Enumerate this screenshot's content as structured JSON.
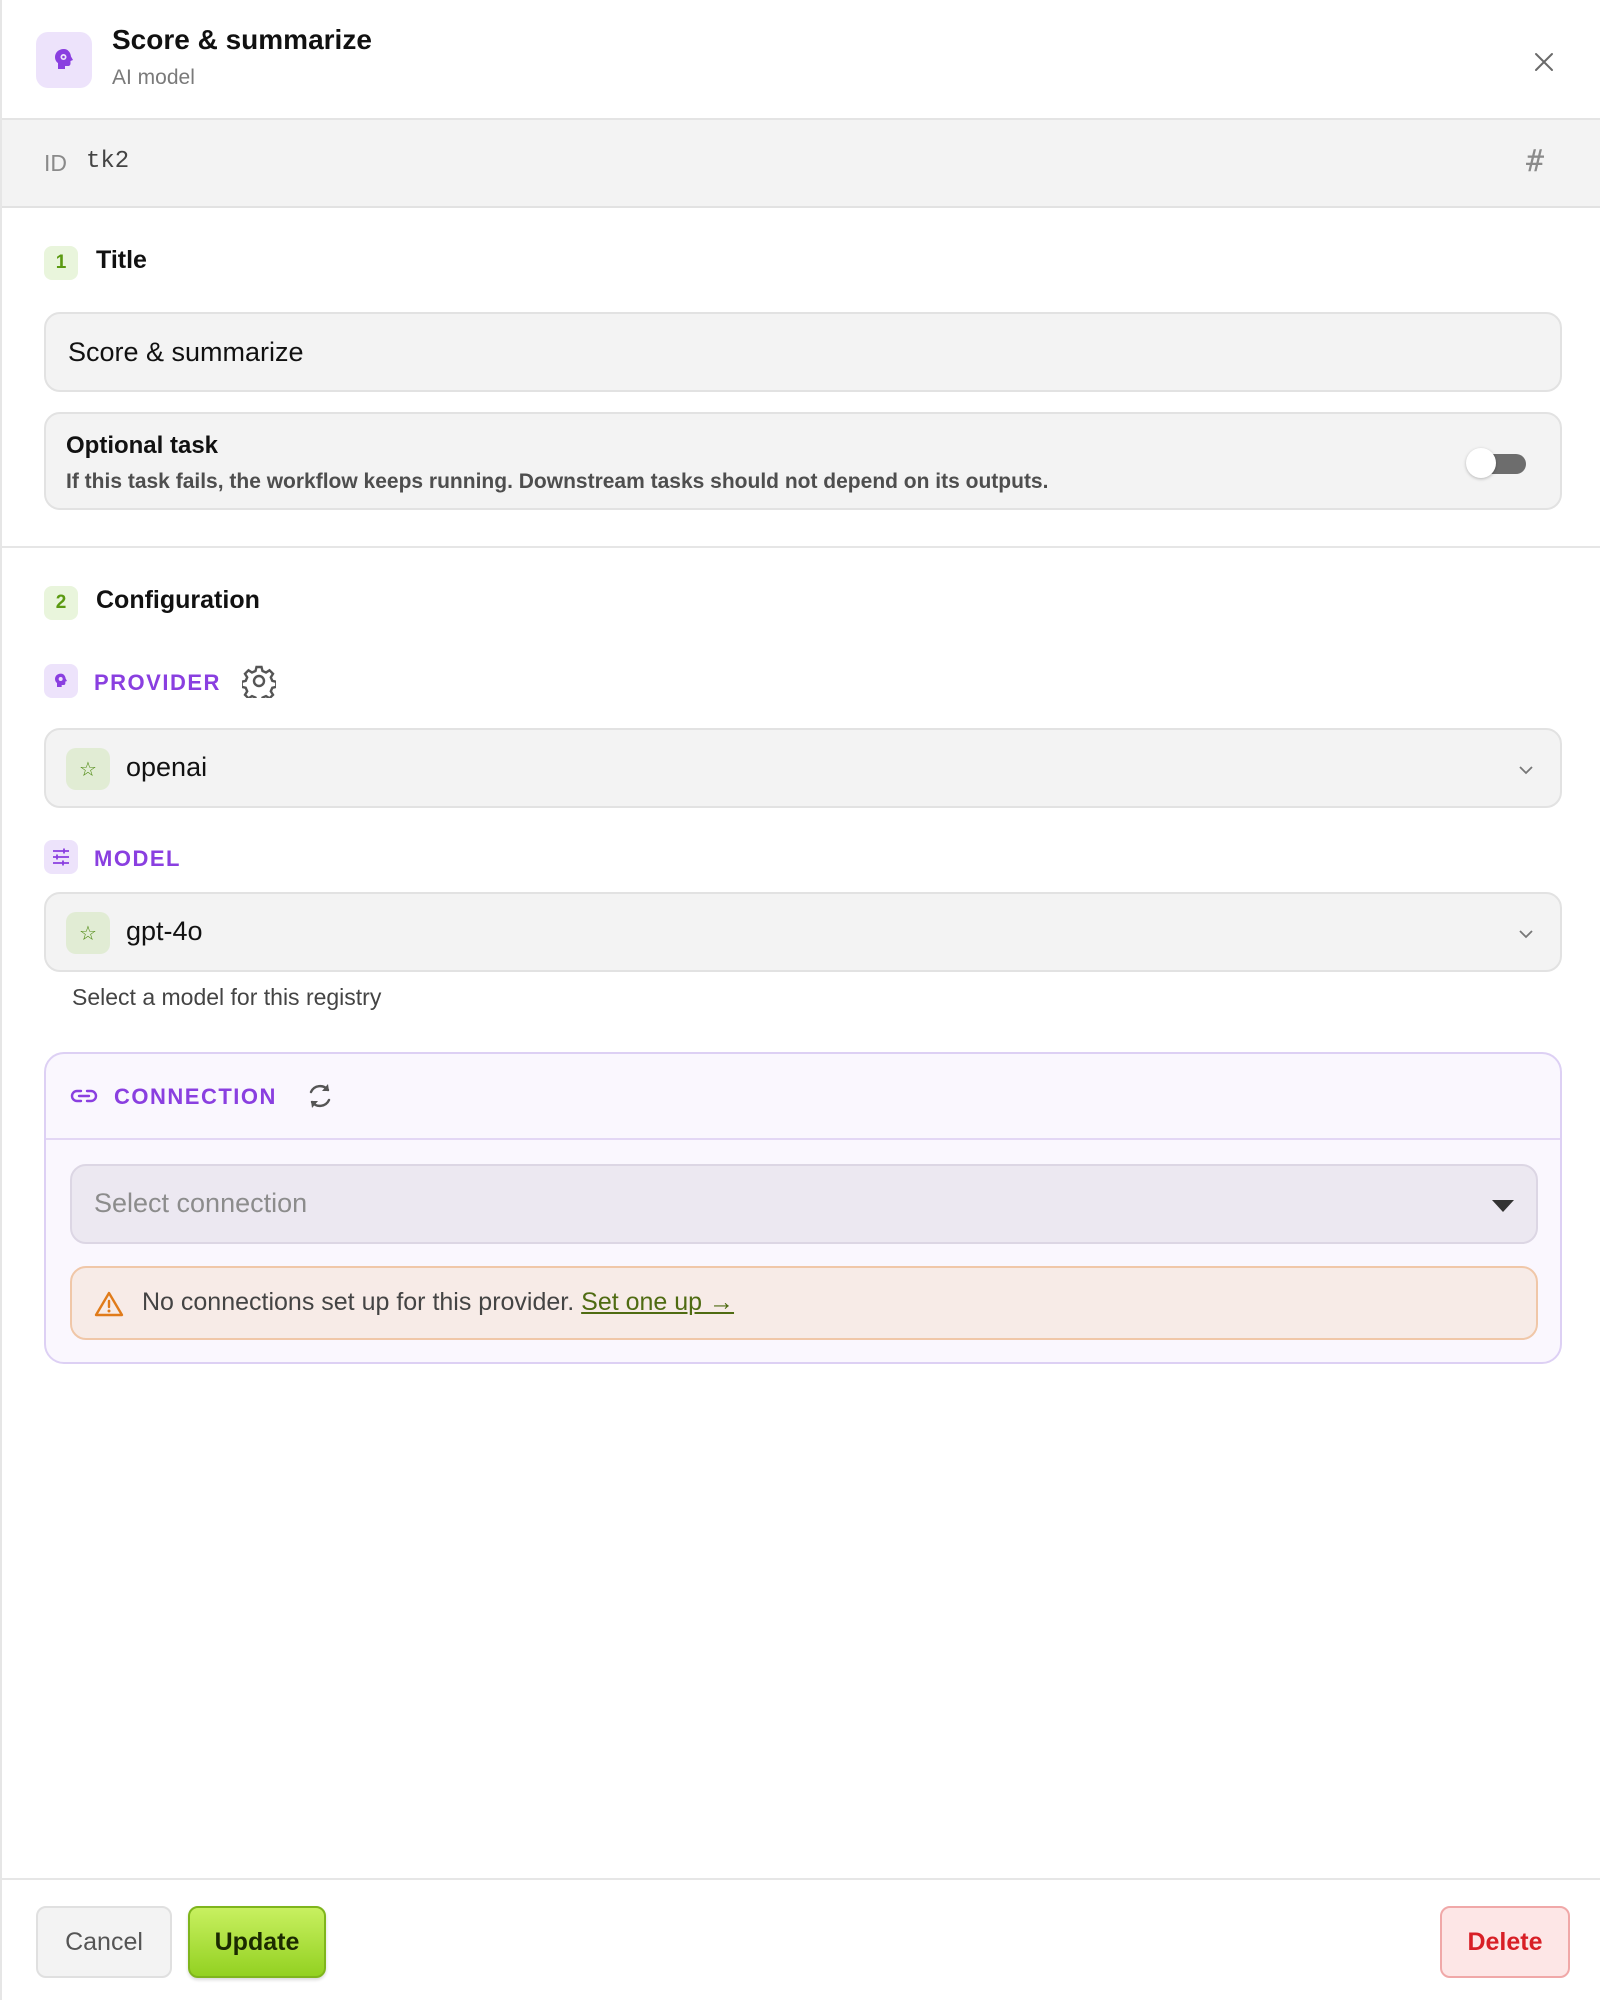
{
  "header": {
    "title": "Score & summarize",
    "subtitle": "AI model",
    "icon": "brain-icon",
    "close_icon": "close-icon"
  },
  "id_bar": {
    "label": "ID",
    "value": "tk2",
    "icon": "hash-icon"
  },
  "section_title": {
    "number": "1",
    "label": "Title",
    "input_value": "Score & summarize"
  },
  "optional_task": {
    "title": "Optional task",
    "description": "If this task fails, the workflow keeps running. Downstream tasks should not depend on its outputs.",
    "enabled": false
  },
  "section_config": {
    "number": "2",
    "label": "Configuration"
  },
  "provider": {
    "label": "PROVIDER",
    "value": "openai",
    "settings_icon": "gear-icon"
  },
  "model": {
    "label": "MODEL",
    "value": "gpt-4o",
    "helper": "Select a model for this registry"
  },
  "connection": {
    "label": "CONNECTION",
    "placeholder": "Select connection",
    "warning_text": "No connections set up for this provider.",
    "warning_link": "Set one up →"
  },
  "footer": {
    "cancel": "Cancel",
    "update": "Update",
    "delete": "Delete"
  },
  "colors": {
    "accent_purple": "#8a3fe0",
    "accent_green": "#93d121",
    "danger": "#d81f26",
    "warning": "#e07b1a"
  }
}
